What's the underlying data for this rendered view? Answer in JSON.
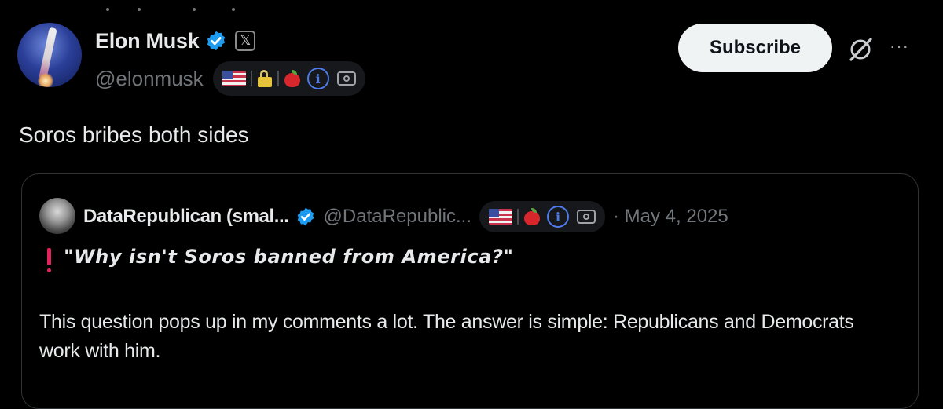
{
  "author": {
    "name": "Elon Musk",
    "handle": "@elonmusk",
    "badge_icons": [
      "us-flag-icon",
      "lock-icon",
      "apple-icon",
      "info-icon",
      "camera-icon"
    ]
  },
  "actions": {
    "subscribe_label": "Subscribe",
    "grok_icon": "grok-icon",
    "more_label": "···"
  },
  "tweet": {
    "text": "Soros bribes both sides"
  },
  "quoted": {
    "author_name": "DataRepublican (smal...",
    "handle": "@DataRepublic...",
    "date": "· May 4, 2025",
    "badge_icons": [
      "us-flag-icon",
      "apple-icon",
      "info-icon",
      "camera-icon"
    ],
    "headline": "\"Why isn't Soros banned from America?\"",
    "body": "This question pops up in my comments a lot. The answer is simple: Republicans and Democrats work with him."
  },
  "colors": {
    "background": "#000000",
    "text": "#e7e9ea",
    "muted": "#71767b",
    "verified": "#1d9bf0",
    "subscribe_bg": "#eff3f4"
  }
}
